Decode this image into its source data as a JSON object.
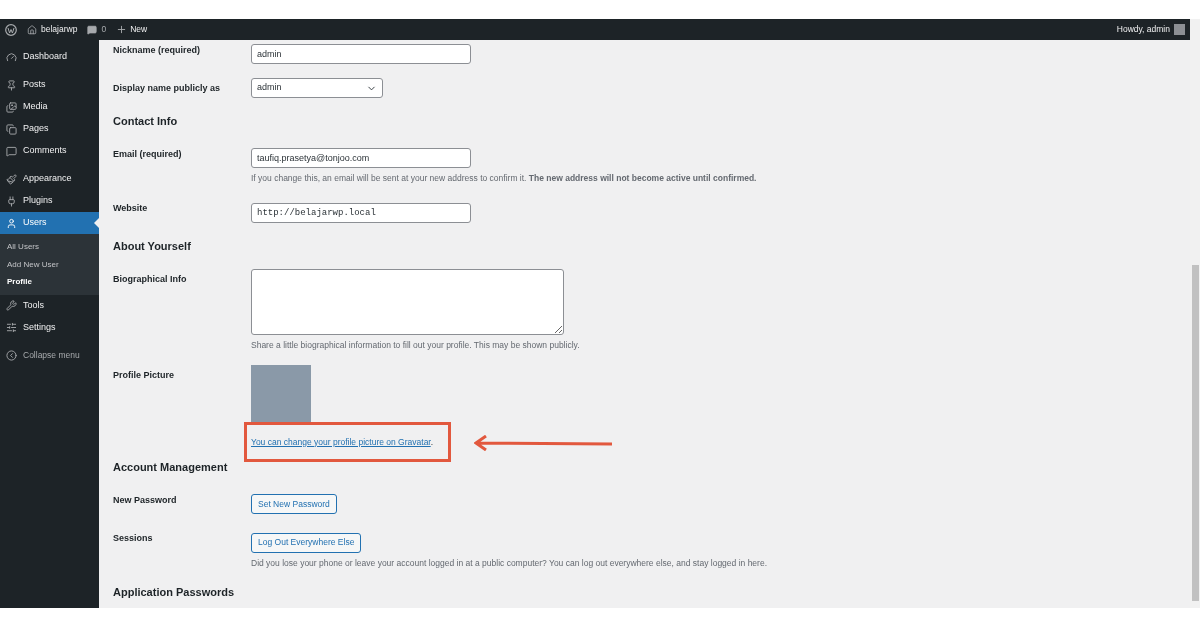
{
  "admin_bar": {
    "site_name": "belajarwp",
    "comments_count": "0",
    "new_label": "New",
    "greeting": "Howdy, admin"
  },
  "sidebar": {
    "groups": [
      {
        "items": [
          {
            "label": "Dashboard",
            "selected": false
          }
        ]
      },
      {
        "items": [
          {
            "label": "Posts",
            "selected": false
          },
          {
            "label": "Media",
            "selected": false
          },
          {
            "label": "Pages",
            "selected": false
          },
          {
            "label": "Comments",
            "selected": false
          }
        ]
      },
      {
        "items": [
          {
            "label": "Appearance",
            "selected": false
          },
          {
            "label": "Plugins",
            "selected": false
          },
          {
            "label": "Users",
            "selected": true,
            "submenu": [
              {
                "label": "All Users",
                "selected": false
              },
              {
                "label": "Add New User",
                "selected": false
              },
              {
                "label": "Profile",
                "selected": true
              }
            ]
          },
          {
            "label": "Tools",
            "selected": false
          },
          {
            "label": "Settings",
            "selected": false
          }
        ]
      }
    ],
    "collapse_label": "Collapse menu"
  },
  "content": {
    "rows": [
      {
        "kind": "field",
        "label": "Nickname (required)",
        "value": "admin"
      },
      {
        "kind": "select",
        "label": "Display name publicly as",
        "value": "admin"
      },
      {
        "kind": "heading",
        "label": "Contact Info"
      },
      {
        "kind": "field",
        "label": "Email (required)",
        "value": "taufiq.prasetya@tonjoo.com",
        "hint": "If you change this, an email will be sent at your new address to confirm it. **The new address will not become active until confirmed.**"
      },
      {
        "kind": "url",
        "label": "Website",
        "value": "http://belajarwp.local"
      },
      {
        "kind": "heading",
        "label": "About Yourself"
      },
      {
        "kind": "textarea",
        "label": "Biographical Info",
        "hint": "Share a little biographical information to fill out your profile. This may be shown publicly."
      },
      {
        "kind": "picture",
        "label": "Profile Picture",
        "link": "You can change your profile picture on Gravatar",
        "after_link": "."
      },
      {
        "kind": "heading",
        "label": "Account Management"
      },
      {
        "kind": "button",
        "label": "New Password",
        "button": "Set New Password"
      },
      {
        "kind": "button",
        "label": "Sessions",
        "button": "Log Out Everywhere Else",
        "hint": "Did you lose your phone or leave your account logged in at a public computer? You can log out everywhere else, and stay logged in here."
      },
      {
        "kind": "heading",
        "label": "Application Passwords"
      }
    ]
  }
}
